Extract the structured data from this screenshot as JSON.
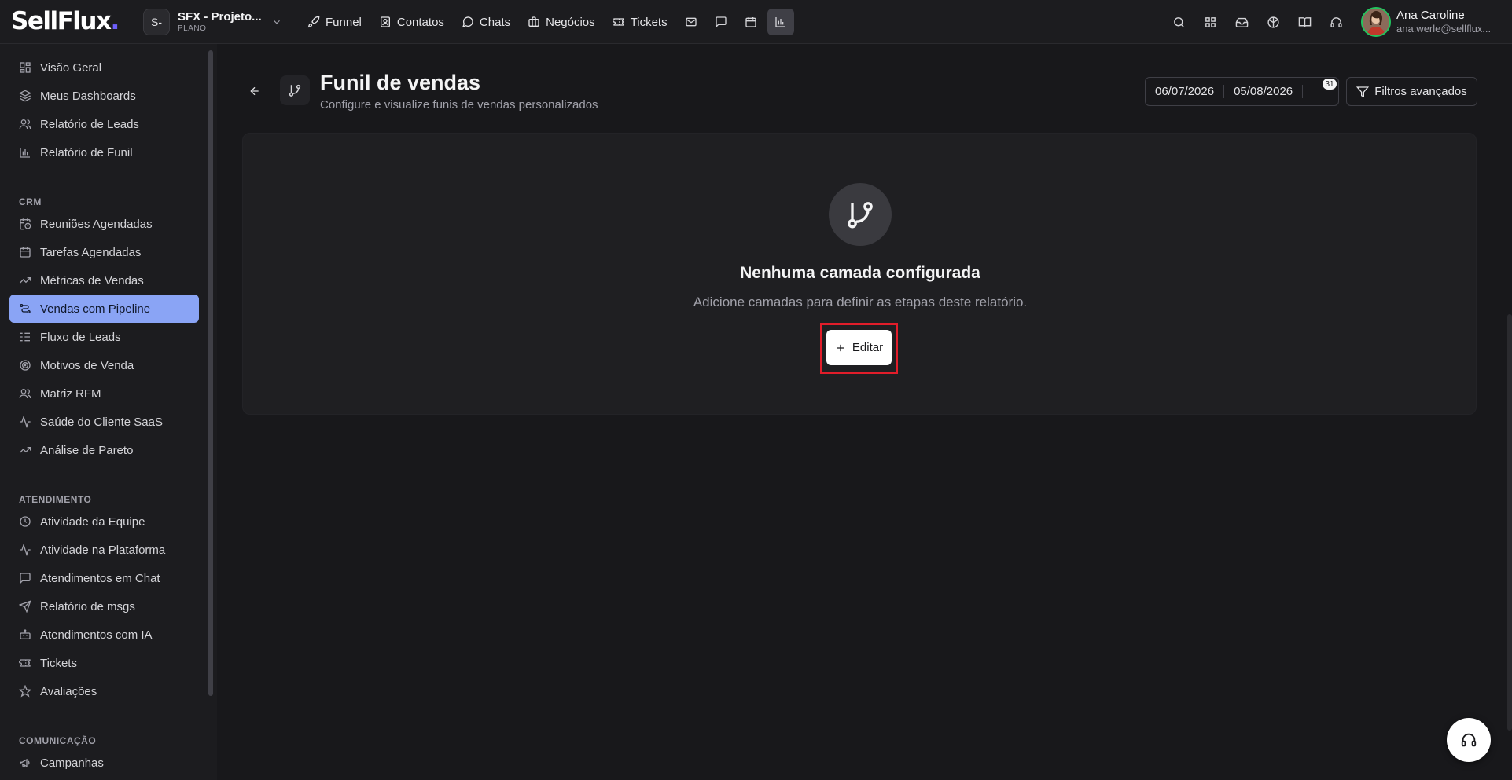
{
  "brand": {
    "name": "SellFlux",
    "dot": "."
  },
  "project": {
    "avatar": "S-",
    "name": "SFX - Projeto...",
    "plan": "PLANO"
  },
  "nav": {
    "funnel": "Funnel",
    "contatos": "Contatos",
    "chats": "Chats",
    "negocios": "Negócios",
    "tickets": "Tickets"
  },
  "user": {
    "name": "Ana Caroline",
    "email": "ana.werle@sellflux..."
  },
  "sidebar": {
    "items_top": [
      {
        "label": "Visão Geral",
        "icon": "grid-icon"
      },
      {
        "label": "Meus Dashboards",
        "icon": "layers-icon"
      },
      {
        "label": "Relatório de Leads",
        "icon": "users-icon"
      },
      {
        "label": "Relatório de Funil",
        "icon": "bar-chart-icon"
      }
    ],
    "crm_title": "CRM",
    "crm": [
      {
        "label": "Reuniões Agendadas",
        "icon": "calendar-clock-icon"
      },
      {
        "label": "Tarefas Agendadas",
        "icon": "calendar-icon"
      },
      {
        "label": "Métricas de Vendas",
        "icon": "trend-icon"
      },
      {
        "label": "Vendas com Pipeline",
        "icon": "pipeline-icon"
      },
      {
        "label": "Fluxo de Leads",
        "icon": "list-icon"
      },
      {
        "label": "Motivos de Venda",
        "icon": "target-icon"
      },
      {
        "label": "Matriz RFM",
        "icon": "users-icon"
      },
      {
        "label": "Saúde do Cliente SaaS",
        "icon": "activity-icon"
      },
      {
        "label": "Análise de Pareto",
        "icon": "trend-icon"
      }
    ],
    "atendimento_title": "ATENDIMENTO",
    "atendimento": [
      {
        "label": "Atividade da Equipe",
        "icon": "clock-icon"
      },
      {
        "label": "Atividade na Plataforma",
        "icon": "activity-icon"
      },
      {
        "label": "Atendimentos em Chat",
        "icon": "chat-icon"
      },
      {
        "label": "Relatório de msgs",
        "icon": "send-icon"
      },
      {
        "label": "Atendimentos com IA",
        "icon": "bot-icon"
      },
      {
        "label": "Tickets",
        "icon": "ticket-icon"
      },
      {
        "label": "Avaliações",
        "icon": "star-icon"
      }
    ],
    "comunicacao_title": "COMUNICAÇÃO",
    "comunicacao": [
      {
        "label": "Campanhas",
        "icon": "megaphone-icon"
      }
    ]
  },
  "page": {
    "title": "Funil de vendas",
    "subtitle": "Configure e visualize funis de vendas personalizados",
    "date_start": "06/07/2026",
    "date_end": "05/08/2026",
    "date_badge": "31",
    "filters_label": "Filtros avançados"
  },
  "empty": {
    "title": "Nenhuma camada configurada",
    "text": "Adicione camadas para definir as etapas deste relatório.",
    "button": "Editar"
  },
  "colors": {
    "background": "#18181b",
    "sidebar_active": "#8aa4f5",
    "highlight": "#e11d2a",
    "brand_dot": "#6d5efc"
  }
}
